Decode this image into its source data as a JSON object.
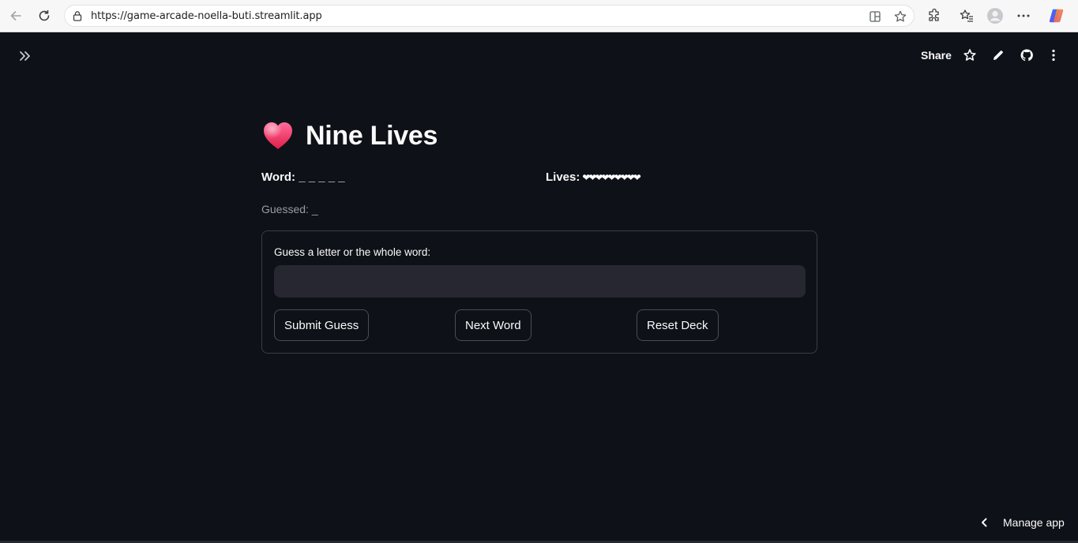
{
  "browser": {
    "url": "https://game-arcade-noella-buti.streamlit.app"
  },
  "header": {
    "share_label": "Share"
  },
  "main": {
    "title": "Nine Lives",
    "word_label": "Word:",
    "word_value": "_ _ _ _ _",
    "lives_label": "Lives:",
    "lives_hearts": "❤❤❤❤❤❤❤❤❤",
    "guessed_label": "Guessed: _"
  },
  "form": {
    "input_label": "Guess a letter or the whole word:",
    "input_value": "",
    "submit_label": "Submit Guess",
    "next_label": "Next Word",
    "reset_label": "Reset Deck"
  },
  "footer": {
    "manage_label": "Manage app"
  },
  "colors": {
    "background": "#0e1117",
    "input_bg": "#262730",
    "heart_gradient_top": "#ff6b9a",
    "heart_gradient_bottom": "#e11d48"
  },
  "icons": {
    "back": "arrow-left-icon",
    "refresh": "refresh-icon",
    "lock": "lock-icon",
    "split_screen": "split-screen-icon",
    "favorite": "star-icon",
    "extensions": "puzzle-icon",
    "favorites_list": "star-list-icon",
    "profile": "profile-icon",
    "more": "ellipsis-icon",
    "copilot": "copilot-icon",
    "sidebar": "double-chevron-right-icon",
    "header_star": "star-icon",
    "edit": "pencil-icon",
    "github": "github-icon",
    "menu": "vertical-ellipsis-icon",
    "manage_chevron": "chevron-left-icon",
    "title_heart": "heart-icon"
  }
}
